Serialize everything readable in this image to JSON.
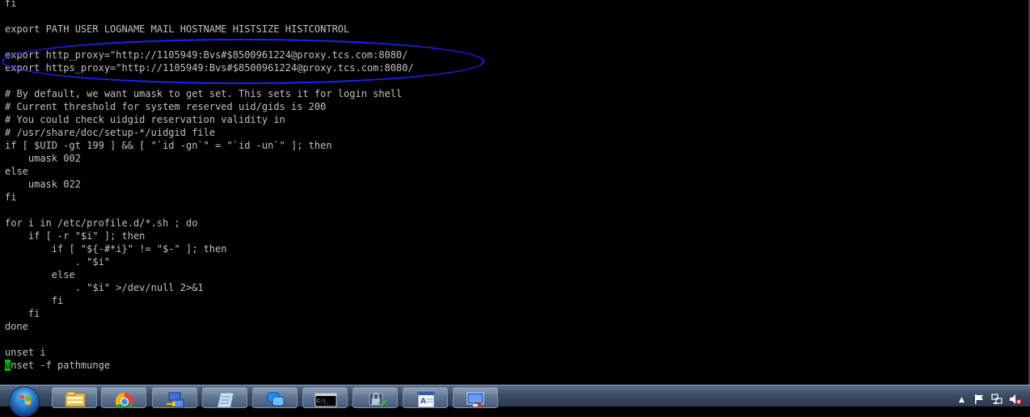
{
  "terminal": {
    "lines": [
      "fi",
      "",
      "export PATH USER LOGNAME MAIL HOSTNAME HISTSIZE HISTCONTROL",
      "",
      "export http_proxy=\"http://1105949:Bvs#$8500961224@proxy.tcs.com:8080/",
      "export https_proxy=\"http://1105949:Bvs#$8500961224@proxy.tcs.com:8080/",
      "",
      "# By default, we want umask to get set. This sets it for login shell",
      "# Current threshold for system reserved uid/gids is 200",
      "# You could check uidgid reservation validity in",
      "# /usr/share/doc/setup-*/uidgid file",
      "if [ $UID -gt 199 ] && [ \"`id -gn`\" = \"`id -un`\" ]; then",
      "    umask 002",
      "else",
      "    umask 022",
      "fi",
      "",
      "for i in /etc/profile.d/*.sh ; do",
      "    if [ -r \"$i\" ]; then",
      "        if [ \"${-#*i}\" != \"$-\" ]; then",
      "            . \"$i\"",
      "        else",
      "            . \"$i\" >/dev/null 2>&1",
      "        fi",
      "    fi",
      "done",
      "",
      "unset i"
    ],
    "cursor_char": "u",
    "last_line_rest": "nset -f pathmunge",
    "colors": {
      "background": "#000000",
      "text": "#c0c0c0",
      "cursor": "#00c000",
      "annotation": "#2020ff"
    }
  },
  "taskbar": {
    "start_icon": "windows-start-orb",
    "apps": [
      {
        "name": "windows-explorer-icon"
      },
      {
        "name": "chrome-icon"
      },
      {
        "name": "network-transfer-icon"
      },
      {
        "name": "notepad-icon"
      },
      {
        "name": "chat-icon"
      },
      {
        "name": "command-prompt-icon"
      },
      {
        "name": "security-lock-icon"
      },
      {
        "name": "document-viewer-icon"
      },
      {
        "name": "remote-desktop-icon"
      }
    ],
    "tray_icons": [
      "show-hidden-icons-arrow",
      "action-center-flag-icon",
      "network-icon",
      "volume-muted-icon"
    ]
  }
}
